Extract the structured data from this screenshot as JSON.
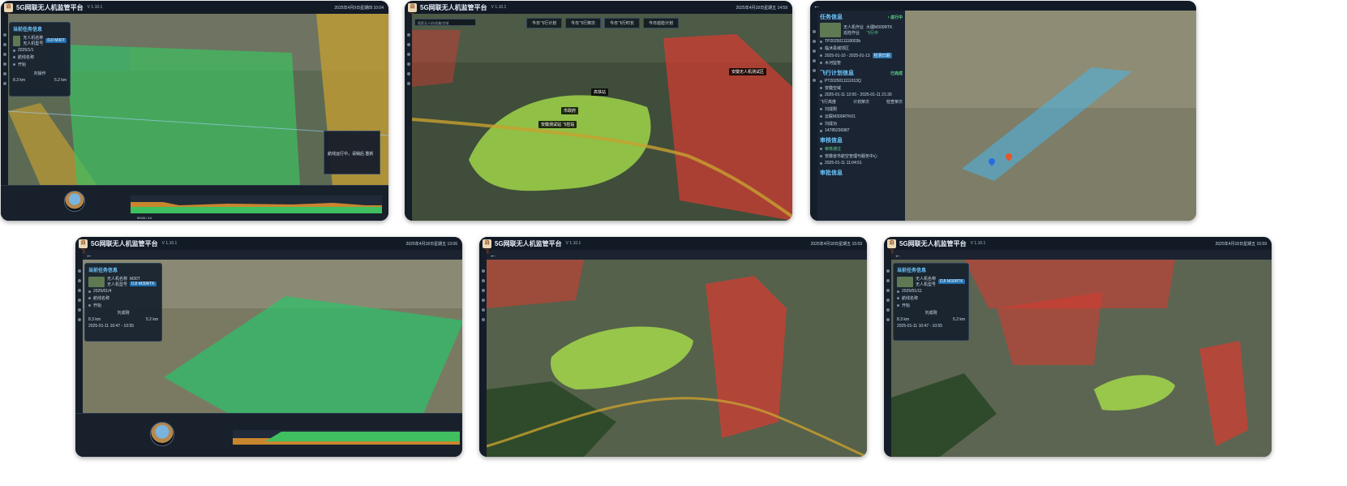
{
  "app": {
    "logo_text": "泊车",
    "title": "5G网联无人机监管平台",
    "version": "V 1.10.1",
    "back_symbol": "←"
  },
  "screens": {
    "s1": {
      "datetime": "2025年4月9日星期四 10:04",
      "card_title": "当前任务信息",
      "card_rows": [
        "无人机名称",
        "无人机型号",
        "2025/1/1",
        "航线名称",
        "开始"
      ],
      "card_tags": [
        "DJI M30T"
      ],
      "dist_a": "8.3 km",
      "dist_b": "5.2 km",
      "pilot": "刘操作",
      "popup_text": "航线运行中，请稍后 重新",
      "bottom_time": "00:00 / 14"
    },
    "s2": {
      "datetime": "2025年4月18日星期五 14:59",
      "search_placeholder": "搜索无人机/机巢/空域",
      "tabs": [
        "今日飞行计划",
        "今日飞行架次",
        "今日飞行时长",
        "今日巡检计划"
      ],
      "labels": [
        "高铁站",
        "市政府",
        "安徽测试站 飞控站",
        "安徽无人机测试区"
      ]
    },
    "s3": {
      "task_title": "任务信息",
      "task_status": "• 进行中",
      "task_rows": [
        "无人机作业",
        "大疆M300RTK",
        "巡检作业",
        "飞行中",
        "TP2025011118003b",
        "临沭县城郊区",
        "2025-01-10 - 2025-01-13",
        "检测日期",
        "木河监管"
      ],
      "plan_title": "飞行计划信息",
      "plan_status": "已完成",
      "plan_rows": [
        "PT2025011111013Q",
        "安徽空域",
        "2025-01-11 12:00 - 2025-01-11 21:30",
        "飞行高度",
        "计划架次",
        "检查架次"
      ],
      "pilot_rows": [
        "刘成刚",
        "云联M300RTK01",
        "刘成功",
        "14785236987"
      ],
      "review_title": "审核信息",
      "review_rows": [
        "审核通过",
        "安徽省市航空管理与服务中心",
        "2025-01-11 11:04:51"
      ],
      "review2_title": "审批信息"
    },
    "s4": {
      "datetime": "2025年4月18日星期五 13:06",
      "card_title": "当前任务信息",
      "card_rows": [
        "无人机名称",
        "无人机型号",
        "2025/01/4",
        "航线名称",
        "开始"
      ],
      "card_tags": [
        "M30T",
        "DJI M30RTK"
      ],
      "pilot": "刘成刚",
      "dist_a": "8.3 km",
      "dist_b": "5.2 km",
      "time_range": "2025-01-11 10:47 - 10:55"
    },
    "s5": {
      "datetime": "2025年4月18日星期五 15:59"
    },
    "s6": {
      "datetime": "2025年4月18日星期五 15:59",
      "card_title": "当前任务信息",
      "card_rows": [
        "无人机名称",
        "无人机型号",
        "2025/01/11",
        "航线名称",
        "开始"
      ],
      "card_tags": [
        "DJI M30RTK"
      ],
      "pilot": "刘成刚",
      "dist_a": "8.3 km",
      "dist_b": "5.2 km",
      "time_range": "2025-01-11 10:47 - 10:55"
    }
  },
  "colors": {
    "flight_zone_green": "#3fbf5f",
    "restricted_red": "#d93a30",
    "highlight_yellow": "#c8a030",
    "accent_blue": "#6ec7ff"
  }
}
